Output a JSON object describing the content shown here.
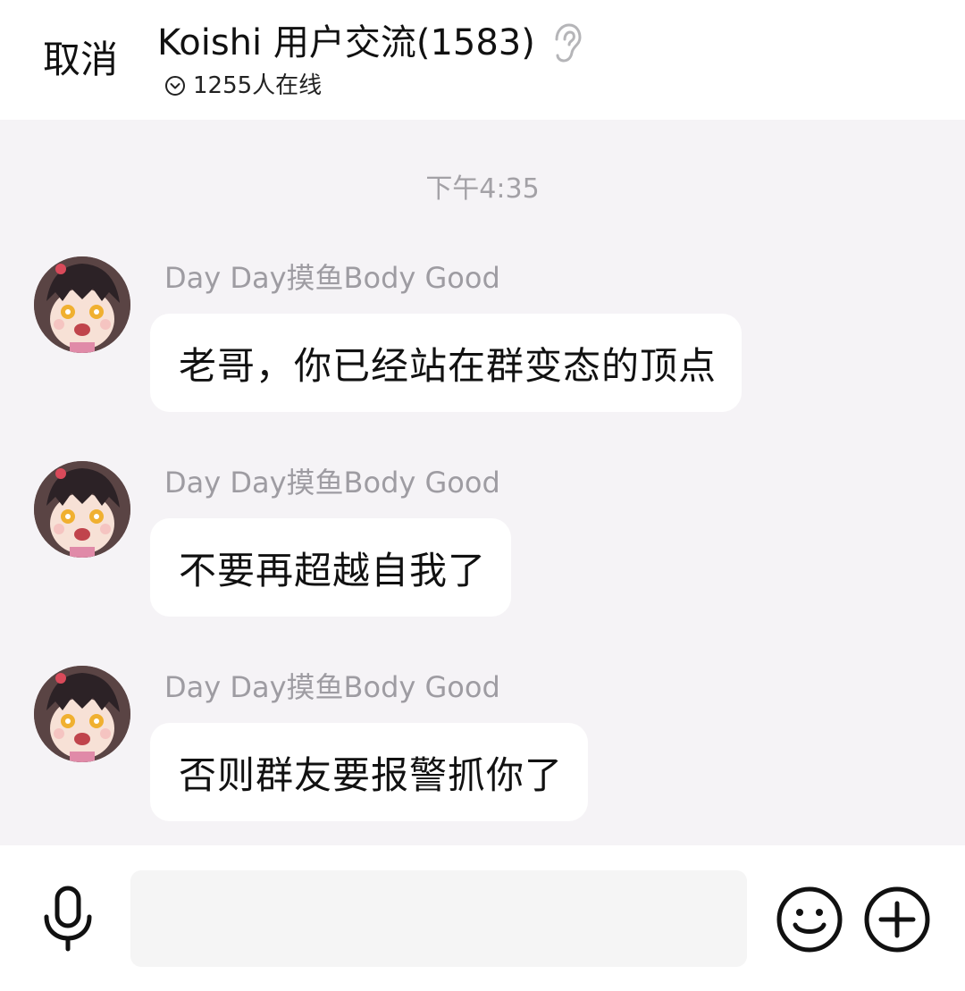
{
  "header": {
    "cancel_label": "取消",
    "title": "Koishi 用户交流(1583)",
    "online_text": "1255人在线",
    "icons": {
      "ear": "ear-icon",
      "status": "chevron-circle-icon"
    }
  },
  "chat": {
    "timestamp": "下午4:35",
    "messages": [
      {
        "sender": "Day Day摸鱼Body Good",
        "text": "老哥，你已经站在群变态的顶点"
      },
      {
        "sender": "Day Day摸鱼Body Good",
        "text": "不要再超越自我了"
      },
      {
        "sender": "Day Day摸鱼Body Good",
        "text": "否则群友要报警抓你了"
      }
    ]
  },
  "input_bar": {
    "placeholder": "",
    "icons": [
      "microphone-icon",
      "emoji-icon",
      "plus-icon"
    ]
  },
  "colors": {
    "chat_background": "#f5f3f6",
    "bubble": "#ffffff",
    "sender_text": "#9e9ca2",
    "timestamp_text": "#a3a1a6"
  }
}
